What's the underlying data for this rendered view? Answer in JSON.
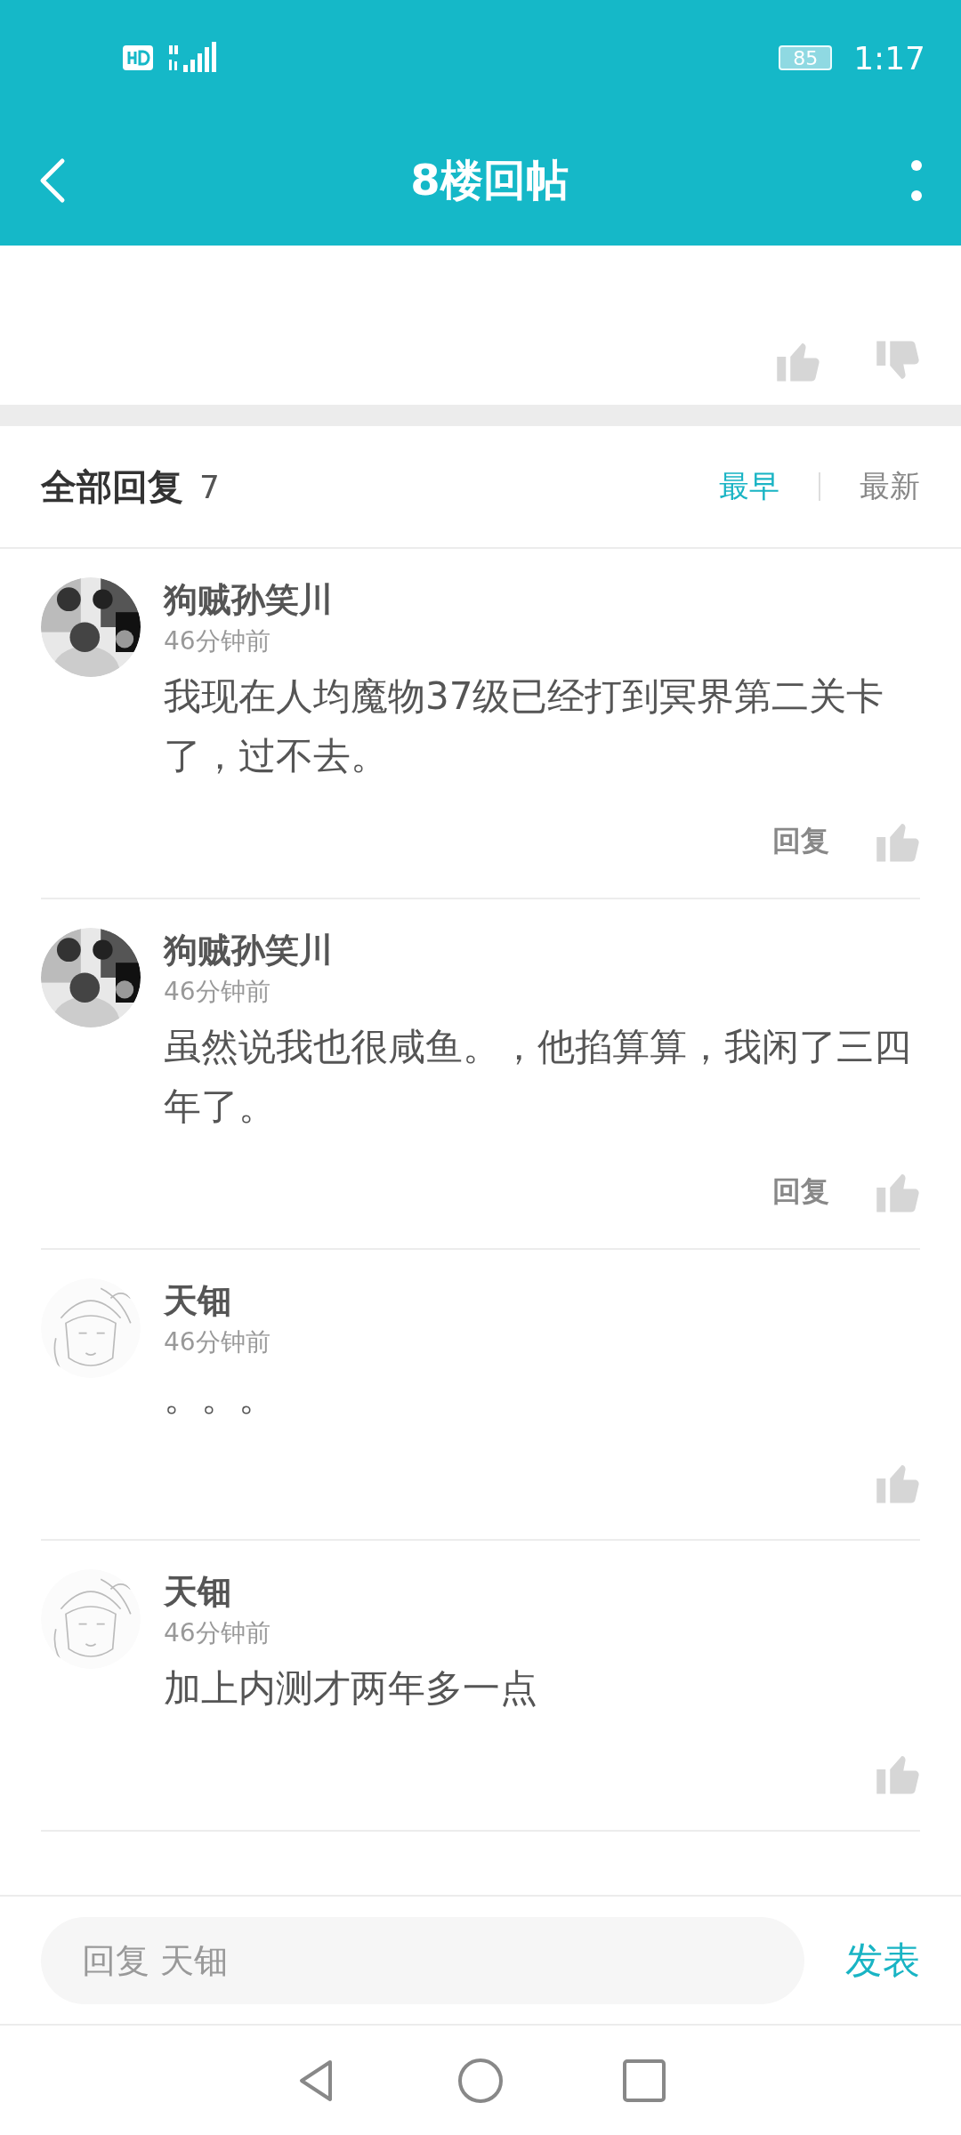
{
  "status_bar": {
    "battery": "85",
    "time": "1:17"
  },
  "toolbar": {
    "title": "8楼回帖"
  },
  "replies_header": {
    "title": "全部回复",
    "count": "7",
    "sort_options": [
      {
        "label": "最早",
        "selected": true
      },
      {
        "label": "最新",
        "selected": false
      }
    ]
  },
  "replies": [
    {
      "author": "狗贼孙笑川",
      "time": "46分钟前",
      "text": "我现在人均魔物37级已经打到冥界第二关卡了，过不去。",
      "reply_label": "回复"
    },
    {
      "author": "狗贼孙笑川",
      "time": "46分钟前",
      "text": "虽然说我也很咸鱼。，他掐算算，我闲了三四年了。",
      "reply_label": "回复"
    },
    {
      "author": "天钿",
      "time": "46分钟前",
      "text": "。。。"
    },
    {
      "author": "天钿",
      "time": "46分钟前",
      "text": "加上内测才两年多一点"
    }
  ],
  "composer": {
    "placeholder": "回复 天钿",
    "submit": "发表"
  }
}
